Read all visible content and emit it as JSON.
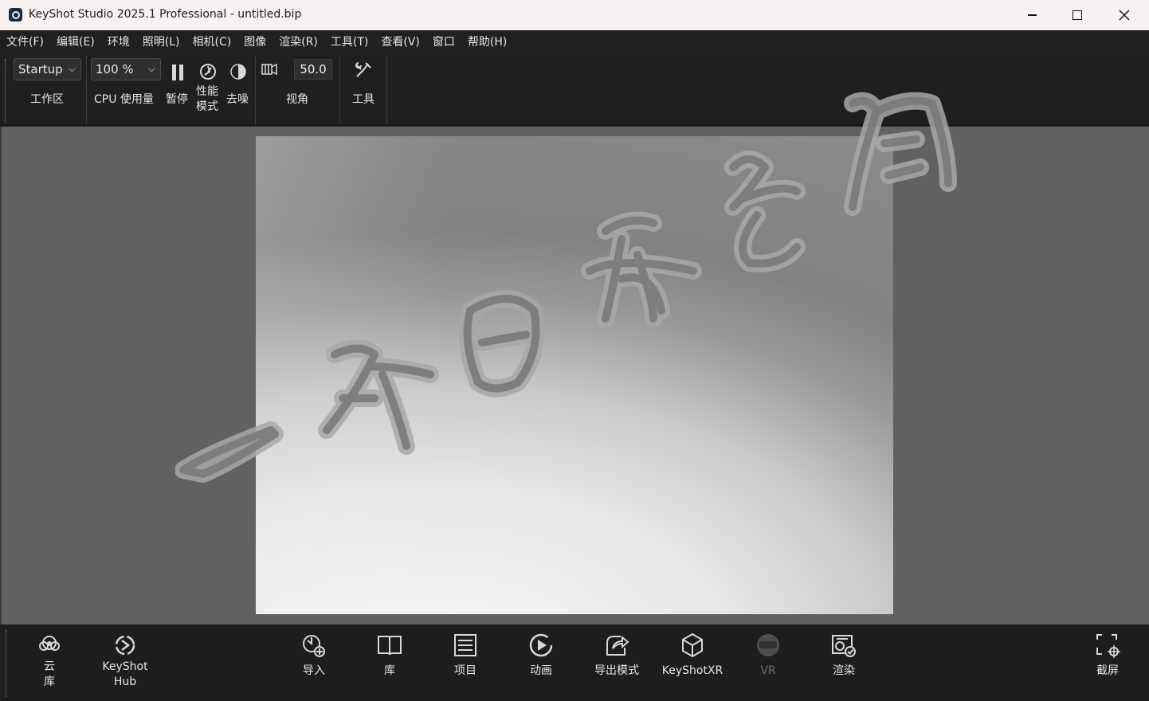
{
  "window": {
    "title": "KeyShot Studio 2025.1 Professional  - untitled.bip"
  },
  "menu": [
    "文件(F)",
    "编辑(E)",
    "环境",
    "照明(L)",
    "相机(C)",
    "图像",
    "渲染(R)",
    "工具(T)",
    "查看(V)",
    "窗口",
    "帮助(H)"
  ],
  "toolbar": {
    "workspace_value": "Startup",
    "workspace_label": "工作区",
    "cpu_value": "100 %",
    "cpu_label": "CPU 使用量",
    "pause_label": "暂停",
    "perf_label_1": "性能",
    "perf_label_2": "模式",
    "denoise_label": "去噪",
    "fov_value": "50.0",
    "fov_label": "视角",
    "tools_label": "工具"
  },
  "watermark_text": "一介白衣书阁",
  "bottombar": {
    "cloud_1": "云",
    "cloud_2": "库",
    "hub_1": "KeyShot",
    "hub_2": "Hub",
    "import": "导入",
    "library": "库",
    "project": "项目",
    "animation": "动画",
    "export_mode": "导出模式",
    "keyshotxr": "KeyShotXR",
    "vr": "VR",
    "render": "渲染",
    "screenshot": "截屏"
  }
}
